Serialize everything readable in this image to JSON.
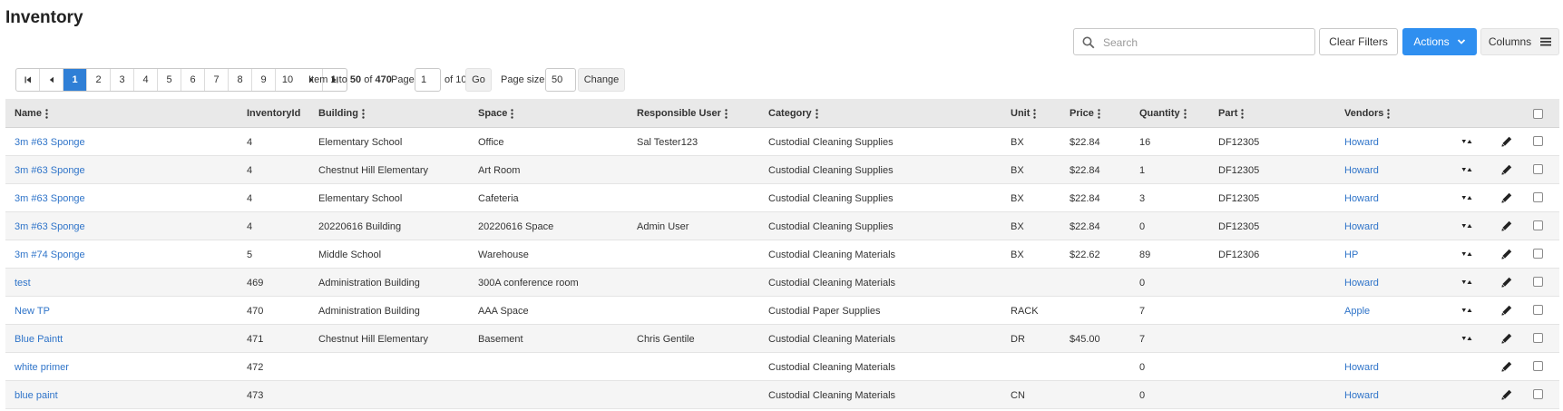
{
  "page": {
    "title": "Inventory"
  },
  "toolbar": {
    "search_placeholder": "Search",
    "clear_filters": "Clear Filters",
    "actions": "Actions",
    "columns": "Columns"
  },
  "pager": {
    "pages": [
      "1",
      "2",
      "3",
      "4",
      "5",
      "6",
      "7",
      "8",
      "9",
      "10"
    ],
    "active_page": "1",
    "item_label": "Item",
    "item_from": "1",
    "to_label": "to",
    "item_to": "50",
    "of_label": "of",
    "item_total": "470",
    "page_label": "Page:",
    "page_value": "1",
    "of_pages": "of 10",
    "go": "Go",
    "page_size_label": "Page size:",
    "page_size_value": "50",
    "change": "Change"
  },
  "table": {
    "headers": {
      "name": "Name",
      "inventory_id": "InventoryId",
      "building": "Building",
      "space": "Space",
      "responsible_user": "Responsible User",
      "category": "Category",
      "unit": "Unit",
      "price": "Price",
      "quantity": "Quantity",
      "part": "Part",
      "vendors": "Vendors"
    },
    "rows": [
      {
        "name": "3m #63 Sponge",
        "inventory_id": "4",
        "building": "Elementary School",
        "space": "Office",
        "responsible_user": "Sal Tester123",
        "category": "Custodial Cleaning Supplies",
        "unit": "BX",
        "price": "$22.84",
        "quantity": "16",
        "part": "DF12305",
        "vendors": "Howard",
        "sort_icon": true
      },
      {
        "name": "3m #63 Sponge",
        "inventory_id": "4",
        "building": "Chestnut Hill Elementary",
        "space": "Art Room",
        "responsible_user": "",
        "category": "Custodial Cleaning Supplies",
        "unit": "BX",
        "price": "$22.84",
        "quantity": "1",
        "part": "DF12305",
        "vendors": "Howard",
        "sort_icon": true
      },
      {
        "name": "3m #63 Sponge",
        "inventory_id": "4",
        "building": "Elementary School",
        "space": "Cafeteria",
        "responsible_user": "",
        "category": "Custodial Cleaning Supplies",
        "unit": "BX",
        "price": "$22.84",
        "quantity": "3",
        "part": "DF12305",
        "vendors": "Howard",
        "sort_icon": true
      },
      {
        "name": "3m #63 Sponge",
        "inventory_id": "4",
        "building": "20220616 Building",
        "space": "20220616 Space",
        "responsible_user": "Admin User",
        "category": "Custodial Cleaning Supplies",
        "unit": "BX",
        "price": "$22.84",
        "quantity": "0",
        "part": "DF12305",
        "vendors": "Howard",
        "sort_icon": true
      },
      {
        "name": "3m #74 Sponge",
        "inventory_id": "5",
        "building": "Middle School",
        "space": "Warehouse",
        "responsible_user": "",
        "category": "Custodial Cleaning Materials",
        "unit": "BX",
        "price": "$22.62",
        "quantity": "89",
        "part": "DF12306",
        "vendors": "HP",
        "sort_icon": true
      },
      {
        "name": "test",
        "inventory_id": "469",
        "building": "Administration Building",
        "space": "300A conference room",
        "responsible_user": "",
        "category": "Custodial Cleaning Materials",
        "unit": "",
        "price": "",
        "quantity": "0",
        "part": "",
        "vendors": "Howard",
        "sort_icon": true
      },
      {
        "name": "New TP",
        "inventory_id": "470",
        "building": "Administration Building",
        "space": "AAA Space",
        "responsible_user": "",
        "category": "Custodial Paper Supplies",
        "unit": "RACK",
        "price": "",
        "quantity": "7",
        "part": "",
        "vendors": "Apple",
        "sort_icon": true
      },
      {
        "name": "Blue Paintt",
        "inventory_id": "471",
        "building": "Chestnut Hill Elementary",
        "space": "Basement",
        "responsible_user": "Chris Gentile",
        "category": "Custodial Cleaning Materials",
        "unit": "DR",
        "price": "$45.00",
        "quantity": "7",
        "part": "",
        "vendors": "",
        "sort_icon": true
      },
      {
        "name": "white primer",
        "inventory_id": "472",
        "building": "",
        "space": "",
        "responsible_user": "",
        "category": "Custodial Cleaning Materials",
        "unit": "",
        "price": "",
        "quantity": "0",
        "part": "",
        "vendors": "Howard",
        "sort_icon": false
      },
      {
        "name": "blue paint",
        "inventory_id": "473",
        "building": "",
        "space": "",
        "responsible_user": "",
        "category": "Custodial Cleaning Materials",
        "unit": "CN",
        "price": "",
        "quantity": "0",
        "part": "",
        "vendors": "Howard",
        "sort_icon": false
      }
    ]
  },
  "icons": {
    "search": "search-icon",
    "chevron": "chevron-down-icon",
    "columns": "menu-bars-icon",
    "kebab": "vertical-dots-icon",
    "sort": "sort-arrows-icon",
    "edit": "pencil-icon"
  },
  "colors": {
    "accent": "#2f8ff0",
    "link": "#2f74c9",
    "active_page": "#2f7fd6",
    "header_bg": "#e9e9e9"
  }
}
